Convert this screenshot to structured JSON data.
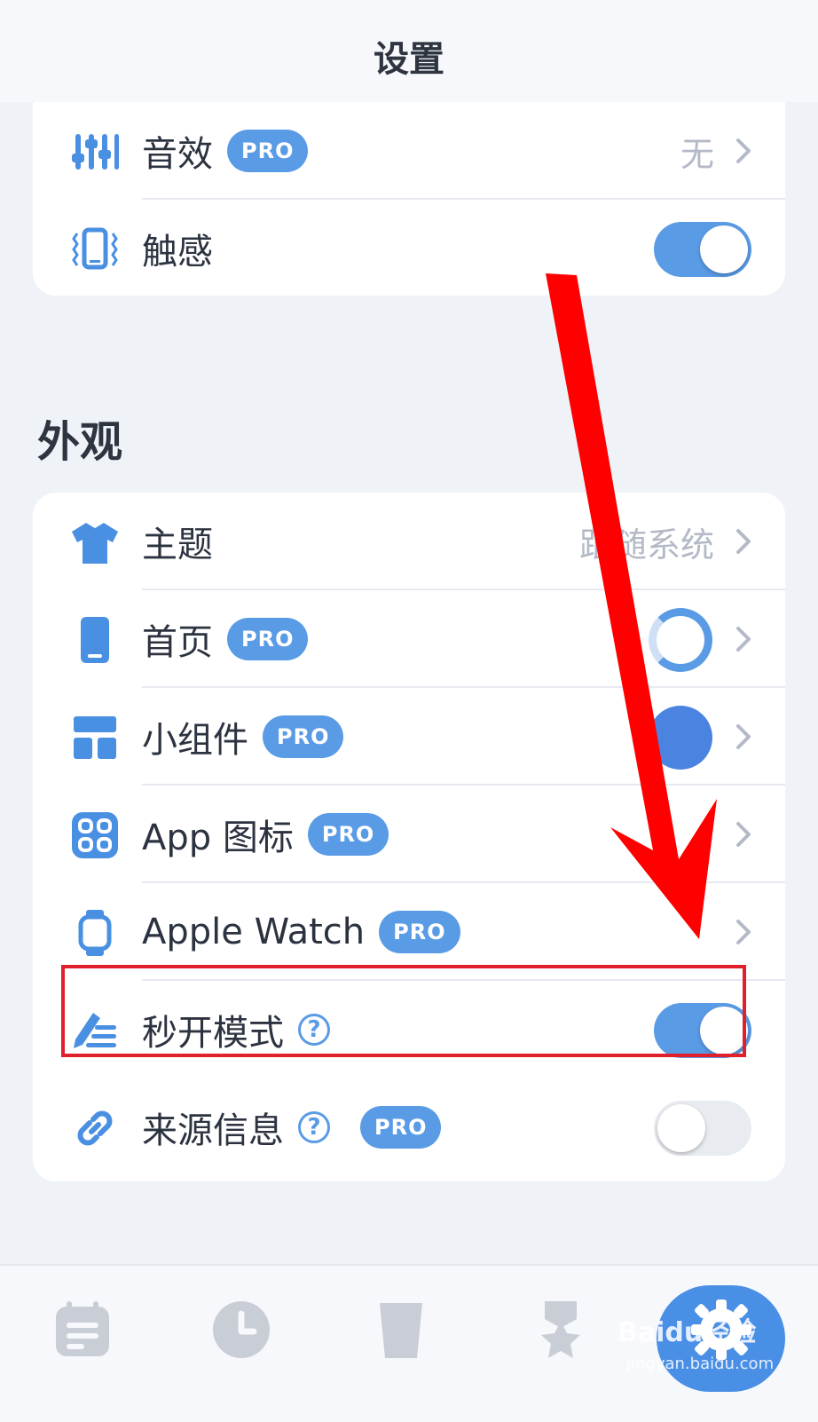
{
  "header": {
    "title": "设置"
  },
  "sound": {
    "label": "音效",
    "badge": "PRO",
    "value": "无"
  },
  "haptics": {
    "label": "触感",
    "toggle": "on"
  },
  "appearance": {
    "section_title": "外观",
    "theme": {
      "label": "主题",
      "value": "跟随系统"
    },
    "home": {
      "label": "首页",
      "badge": "PRO"
    },
    "widgets": {
      "label": "小组件",
      "badge": "PRO"
    },
    "app_icon": {
      "label": "App 图标",
      "badge": "PRO"
    },
    "apple_watch": {
      "label": "Apple Watch",
      "badge": "PRO"
    },
    "quick_launch": {
      "label": "秒开模式",
      "help": "?",
      "toggle": "on"
    },
    "source_info": {
      "label": "来源信息",
      "help": "?",
      "badge": "PRO",
      "toggle": "off"
    }
  },
  "tabbar": {
    "tabs": [
      "list-icon",
      "clock-icon",
      "cup-icon",
      "award-icon",
      "gear-icon"
    ],
    "active": "gear-icon"
  },
  "watermark": {
    "brand": "Baidu经验",
    "url": "jingyan.baidu.com"
  },
  "colors": {
    "accent": "#5a9be6",
    "highlight": "#e0202a",
    "arrow": "#ff0000"
  }
}
